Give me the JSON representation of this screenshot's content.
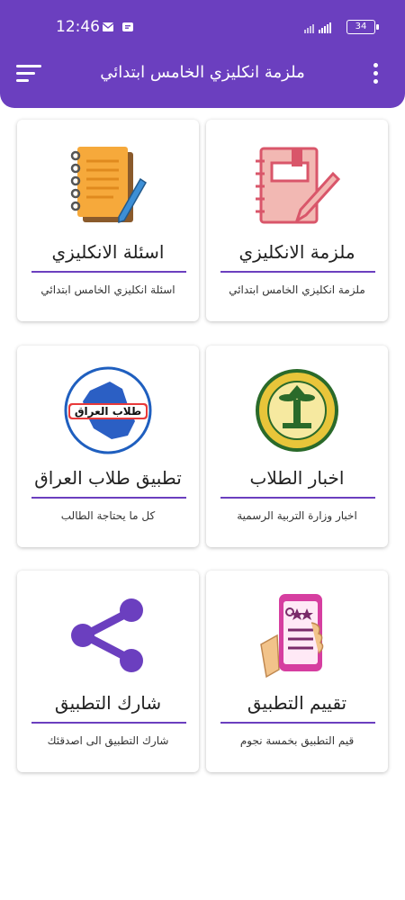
{
  "status": {
    "time": "12:46",
    "battery": "34"
  },
  "appbar": {
    "title": "ملزمة انكليزي الخامس ابتدائي"
  },
  "colors": {
    "primary": "#6b3fbf",
    "accent_line": "#6b3fbf"
  },
  "cards": [
    {
      "title": "ملزمة الانكليزي",
      "subtitle": "ملزمة انكليزي الخامس ابتدائي",
      "icon": "notebook-pen-icon"
    },
    {
      "title": "اسئلة الانكليزي",
      "subtitle": "اسئلة انكليزي الخامس ابتدائي",
      "icon": "notepad-pencil-icon"
    },
    {
      "title": "اخبار الطلاب",
      "subtitle": "اخبار وزارة التربية الرسمية",
      "icon": "ministry-seal-icon"
    },
    {
      "title": "تطبيق طلاب العراق",
      "subtitle": "كل ما يحتاجة الطالب",
      "icon": "iraq-map-icon",
      "logo_text": "طلاب العراق"
    },
    {
      "title": "تقييم التطبيق",
      "subtitle": "قيم التطبيق بخمسة نجوم",
      "icon": "rate-phone-icon"
    },
    {
      "title": "شارك التطبيق",
      "subtitle": "شارك التطبيق الى اصدقئك",
      "icon": "share-icon"
    }
  ]
}
